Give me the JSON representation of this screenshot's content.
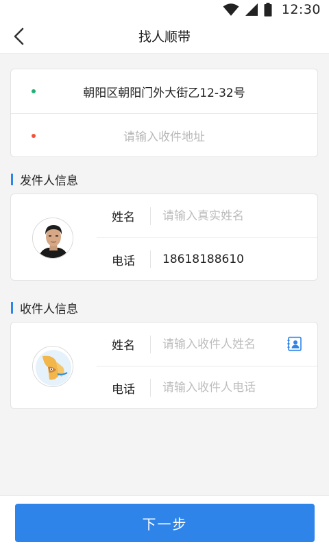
{
  "status_bar": {
    "time": "12:30",
    "icons": [
      "wifi-icon",
      "signal-icon",
      "battery-icon"
    ]
  },
  "header": {
    "title": "找人顺带",
    "back_icon": "chevron-left-icon"
  },
  "address": {
    "from": "朝阳区朝阳门外大街乙12-32号",
    "to_placeholder": "请输入收件地址",
    "from_dot_color": "#21b073",
    "to_dot_color": "#f0533a"
  },
  "sender": {
    "section_title": "发件人信息",
    "name_label": "姓名",
    "name_placeholder": "请输入真实姓名",
    "name_value": "",
    "phone_label": "电话",
    "phone_value": "18618188610"
  },
  "receiver": {
    "section_title": "收件人信息",
    "name_label": "姓名",
    "name_placeholder": "请输入收件人姓名",
    "phone_label": "电话",
    "phone_placeholder": "请输入收件人电话",
    "contact_icon": "contact-book-icon"
  },
  "footer": {
    "next_label": "下一步"
  },
  "colors": {
    "accent": "#2f84ea",
    "section_bar": "#2f84e8"
  }
}
